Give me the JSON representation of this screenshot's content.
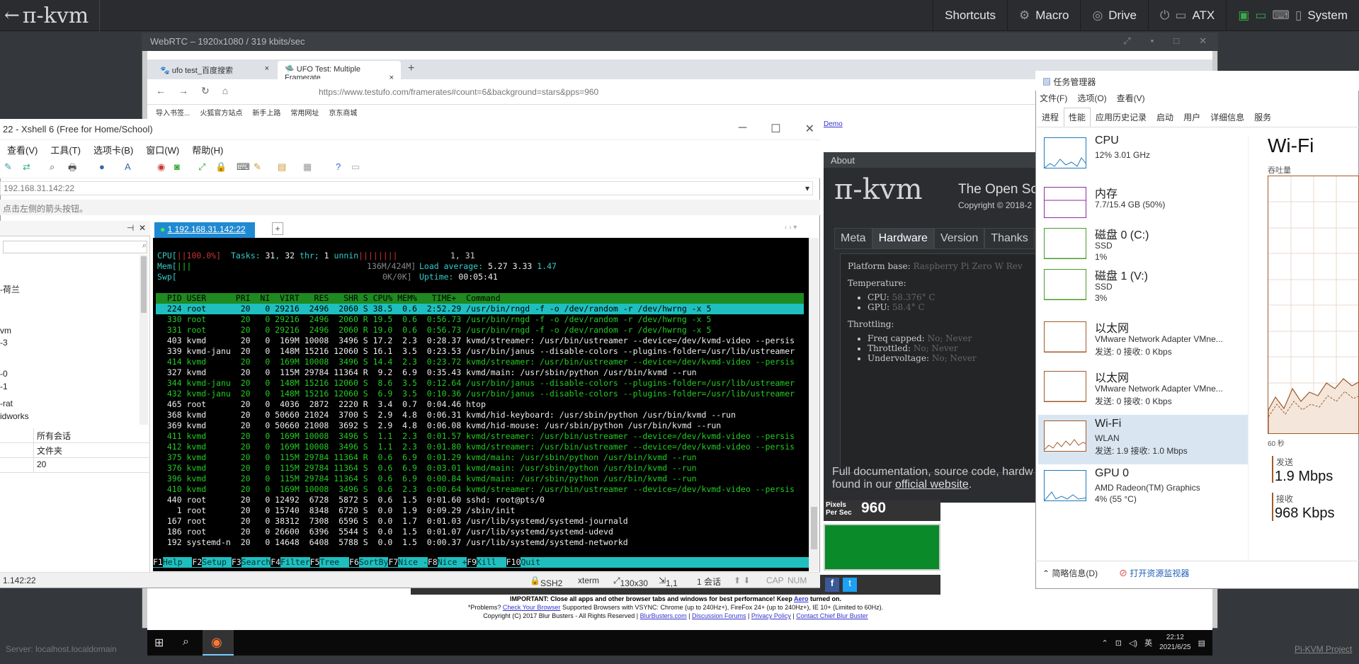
{
  "kvm": {
    "logo": "π-kvm",
    "menu": [
      "Shortcuts",
      "Macro",
      "Drive",
      "ATX",
      "System"
    ],
    "stream_title": "WebRTC – 1920x1080 / 319 kbits/sec",
    "server": "Server: localhost.localdomain",
    "project_link": "Pi-KVM Project"
  },
  "browser": {
    "tabs": [
      "ufo test_百度搜索",
      "UFO Test: Multiple Framerate"
    ],
    "url": "https://www.testufo.com/framerates#count=6&background=stars&pps=960",
    "bookmarks": [
      "导入书签...",
      "火狐官方站点",
      "新手上路",
      "常用网址",
      "京东商城"
    ],
    "demo_link": "Demo"
  },
  "about": {
    "header": "About",
    "logo": "π-kvm",
    "tagline": "The Open So",
    "copyright": "Copyright © 2018-2",
    "tabs": [
      "Meta",
      "Hardware",
      "Version",
      "Thanks"
    ],
    "platform_label": "Platform base:",
    "platform_value": "Raspberry Pi Zero W Rev",
    "temperature_label": "Temperature:",
    "cpu_temp_label": "CPU:",
    "cpu_temp": "58.376° C",
    "gpu_temp_label": "GPU:",
    "gpu_temp": "58.4° C",
    "throttling_label": "Throttling:",
    "freq_label": "Freq capped:",
    "freq_value": "No; Never",
    "throttled_label": "Throttled:",
    "throttled_value": "No; Never",
    "undervolt_label": "Undervoltage:",
    "undervolt_value": "No; Never",
    "docs_text": "Full documentation, source code, hardw found in our",
    "docs_link": "official website"
  },
  "ufo": {
    "pps_label1": "Pixels",
    "pps_label2": "Per Sec",
    "pps_value": "960",
    "important_title": "IMPORTANT: Close all apps and other browser tabs and windows for best performance! Keep",
    "important_link": "Aero",
    "important_tail": "turned on.",
    "problems": "*Problems?",
    "check_browser": "Check Your Browser",
    "supported": "Supported Browsers with VSYNC: Chrome (up to 240Hz+), FireFox 24+ (up to 240Hz+), IE 10+ (Limited to 60Hz).",
    "copyright_line": "Copyright (C) 2017 Blur Busters - All Rights Reserved |",
    "link_blurbusters": "BlurBusters.com",
    "link_forums": "Discussion Forums",
    "link_privacy": "Privacy Policy",
    "link_contact": "Contact Chief Blur Buster"
  },
  "taskbar": {
    "time": "22:12",
    "date": "2021/6/25",
    "ime": "英"
  },
  "xshell": {
    "title": "22 - Xshell 6 (Free for Home/School)",
    "menu": [
      "查看(V)",
      "工具(T)",
      "选项卡(B)",
      "窗口(W)",
      "帮助(H)"
    ],
    "address": "192.168.31.142:22",
    "hint": "点击左侧的箭头按钮。",
    "tree": [
      "-荷兰",
      "vm",
      "-3",
      "-0",
      "-1",
      "-rat",
      "idworks"
    ],
    "props": [
      {
        "value": "所有会话"
      },
      {
        "value": "文件夹"
      },
      {
        "value": "20"
      }
    ],
    "session_tab": "1 192.168.31.142:22",
    "status_left": "1.142:22",
    "status_proto": "SSH2",
    "status_term": "xterm",
    "status_size": "130x30",
    "status_pos": "1,1",
    "status_sessions": "1 会话",
    "status_cap": "CAP",
    "status_num": "NUM"
  },
  "htop": {
    "cpu_label": "CPU[",
    "cpu_bar": "||100.0%]",
    "mem_label": "Mem[",
    "mem_bar": "|||",
    "mem_val": "136M/424M]",
    "swp_label": "Swp[",
    "swp_val": "0K/0K]",
    "tasks_label": "Tasks:",
    "tasks": "31",
    "thr": "32",
    "running": "1",
    "run_bar": "||||||||",
    "running_line_tail": "1, 31",
    "load_label": "Load average:",
    "load1": "5.27",
    "load2": "3.33",
    "load3": "1.47",
    "uptime_label": "Uptime:",
    "uptime": "00:05:41",
    "header": "  PID USER      PRI  NI  VIRT   RES   SHR S CPU% MEM%   TIME+  Command",
    "rows": [
      {
        "line": "  224 root       20   0 29216  2496  2060 S 38.5  0.6  2:52.29 /usr/bin/rngd -f -o /dev/random -r /dev/hwrng -x 5",
        "cls": "sel"
      },
      {
        "line": "  330 root       20   0 29216  2496  2060 R 19.5  0.6  0:56.73 /usr/bin/rngd -f -o /dev/random -r /dev/hwrng -x 5",
        "cls": "g"
      },
      {
        "line": "  331 root       20   0 29216  2496  2060 R 19.0  0.6  0:56.73 /usr/bin/rngd -f -o /dev/random -r /dev/hwrng -x 5",
        "cls": "g"
      },
      {
        "line": "  403 kvmd       20   0  169M 10008  3496 S 17.2  2.3  0:28.37 kvmd/streamer: /usr/bin/ustreamer --device=/dev/kvmd-video --persis",
        "cls": "w"
      },
      {
        "line": "  339 kvmd-janu  20   0  148M 15216 12060 S 16.1  3.5  0:23.53 /usr/bin/janus --disable-colors --plugins-folder=/usr/lib/ustreamer",
        "cls": "w"
      },
      {
        "line": "  414 kvmd       20   0  169M 10008  3496 S 14.4  2.3  0:23.72 kvmd/streamer: /usr/bin/ustreamer --device=/dev/kvmd-video --persis",
        "cls": "g"
      },
      {
        "line": "  327 kvmd       20   0  115M 29784 11364 R  9.2  6.9  0:35.43 kvmd/main: /usr/sbin/python /usr/bin/kvmd --run",
        "cls": "w"
      },
      {
        "line": "  344 kvmd-janu  20   0  148M 15216 12060 S  8.6  3.5  0:12.64 /usr/bin/janus --disable-colors --plugins-folder=/usr/lib/ustreamer",
        "cls": "g"
      },
      {
        "line": "  432 kvmd-janu  20   0  148M 15216 12060 S  6.9  3.5  0:10.36 /usr/bin/janus --disable-colors --plugins-folder=/usr/lib/ustreamer",
        "cls": "g"
      },
      {
        "line": "  465 root       20   0  4036  2872  2220 R  3.4  0.7  0:04.46 htop",
        "cls": "w"
      },
      {
        "line": "  368 kvmd       20   0 50660 21024  3700 S  2.9  4.8  0:06.31 kvmd/hid-keyboard: /usr/sbin/python /usr/bin/kvmd --run",
        "cls": "w"
      },
      {
        "line": "  369 kvmd       20   0 50660 21008  3692 S  2.9  4.8  0:06.08 kvmd/hid-mouse: /usr/sbin/python /usr/bin/kvmd --run",
        "cls": "w"
      },
      {
        "line": "  411 kvmd       20   0  169M 10008  3496 S  1.1  2.3  0:01.57 kvmd/streamer: /usr/bin/ustreamer --device=/dev/kvmd-video --persis",
        "cls": "g"
      },
      {
        "line": "  412 kvmd       20   0  169M 10008  3496 S  1.1  2.3  0:01.80 kvmd/streamer: /usr/bin/ustreamer --device=/dev/kvmd-video --persis",
        "cls": "g"
      },
      {
        "line": "  375 kvmd       20   0  115M 29784 11364 R  0.6  6.9  0:01.29 kvmd/main: /usr/sbin/python /usr/bin/kvmd --run",
        "cls": "g"
      },
      {
        "line": "  376 kvmd       20   0  115M 29784 11364 S  0.6  6.9  0:03.01 kvmd/main: /usr/sbin/python /usr/bin/kvmd --run",
        "cls": "g"
      },
      {
        "line": "  396 kvmd       20   0  115M 29784 11364 S  0.6  6.9  0:00.84 kvmd/main: /usr/sbin/python /usr/bin/kvmd --run",
        "cls": "g"
      },
      {
        "line": "  410 kvmd       20   0  169M 10008  3496 S  0.6  2.3  0:00.64 kvmd/streamer: /usr/bin/ustreamer --device=/dev/kvmd-video --persis",
        "cls": "g"
      },
      {
        "line": "  440 root       20   0 12492  6728  5872 S  0.6  1.5  0:01.60 sshd: root@pts/0",
        "cls": "w"
      },
      {
        "line": "    1 root       20   0 15740  8348  6720 S  0.0  1.9  0:09.29 /sbin/init",
        "cls": "w"
      },
      {
        "line": "  167 root       20   0 38312  7308  6596 S  0.0  1.7  0:01.03 /usr/lib/systemd/systemd-journald",
        "cls": "w"
      },
      {
        "line": "  186 root       20   0 26600  6396  5544 S  0.0  1.5  0:01.07 /usr/lib/systemd/systemd-udevd",
        "cls": "w"
      },
      {
        "line": "  192 systemd-n  20   0 14648  6408  5788 S  0.0  1.5  0:00.37 /usr/lib/systemd/systemd-networkd",
        "cls": "w"
      }
    ],
    "fkeys": [
      {
        "k": "F1",
        "v": "Help  "
      },
      {
        "k": "F2",
        "v": "Setup "
      },
      {
        "k": "F3",
        "v": "Search"
      },
      {
        "k": "F4",
        "v": "Filter"
      },
      {
        "k": "F5",
        "v": "Tree  "
      },
      {
        "k": "F6",
        "v": "SortBy"
      },
      {
        "k": "F7",
        "v": "Nice -"
      },
      {
        "k": "F8",
        "v": "Nice +"
      },
      {
        "k": "F9",
        "v": "Kill  "
      },
      {
        "k": "F10",
        "v": "Quit"
      }
    ]
  },
  "taskmgr": {
    "title": "任务管理器",
    "menu": [
      "文件(F)",
      "选项(O)",
      "查看(V)"
    ],
    "tabs": [
      "进程",
      "性能",
      "应用历史记录",
      "启动",
      "用户",
      "详细信息",
      "服务"
    ],
    "items": [
      {
        "name": "CPU",
        "sub1": "12% 3.01 GHz",
        "sub2": "",
        "sub3": "",
        "color": "#1f7ab8"
      },
      {
        "name": "内存",
        "sub1": "7.7/15.4 GB (50%)",
        "sub2": "",
        "sub3": "",
        "color": "#8b2e9b"
      },
      {
        "name": "磁盘 0 (C:)",
        "sub1": "SSD",
        "sub2": "1%",
        "sub3": "",
        "color": "#4a9a2a"
      },
      {
        "name": "磁盘 1 (V:)",
        "sub1": "SSD",
        "sub2": "3%",
        "sub3": "",
        "color": "#4a9a2a"
      },
      {
        "name": "以太网",
        "sub1": "VMware Network Adapter VMne...",
        "sub2": "发送: 0 接收: 0 Kbps",
        "sub3": "",
        "color": "#a05a2a"
      },
      {
        "name": "以太网",
        "sub1": "VMware Network Adapter VMne...",
        "sub2": "发送: 0 接收: 0 Kbps",
        "sub3": "",
        "color": "#a05a2a"
      },
      {
        "name": "Wi-Fi",
        "sub1": "WLAN",
        "sub2": "发送: 1.9 接收: 1.0 Mbps",
        "sub3": "",
        "color": "#a05a2a"
      },
      {
        "name": "GPU 0",
        "sub1": "AMD Radeon(TM) Graphics",
        "sub2": "4% (55 °C)",
        "sub3": "",
        "color": "#1f7ab8"
      }
    ],
    "selected_index": 6,
    "detail_title": "Wi-Fi",
    "throughput_label": "吞吐量",
    "seconds": "60 秒",
    "send_label": "发送",
    "send_value": "1.9 Mbps",
    "recv_label": "接收",
    "recv_value": "968 Kbps",
    "fewer_details": "简略信息(D)",
    "open_monitor": "打开资源监视器",
    "accent": "#a05a2a"
  }
}
